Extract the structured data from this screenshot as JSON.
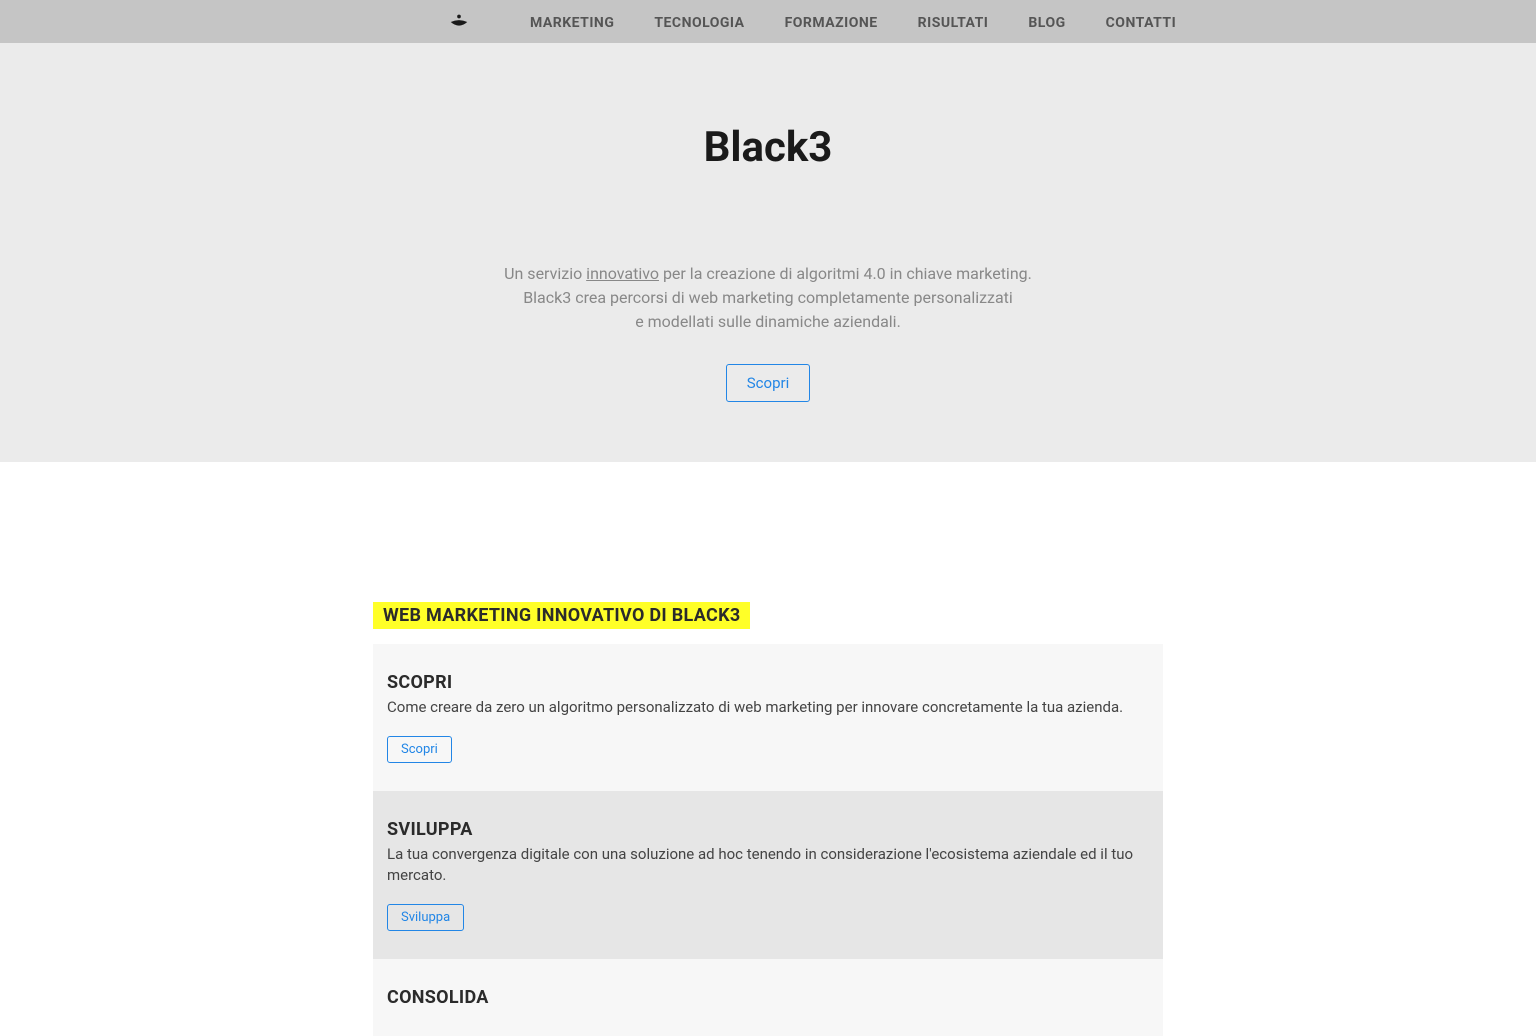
{
  "nav": {
    "items": [
      {
        "label": "MARKETING"
      },
      {
        "label": "TECNOLOGIA"
      },
      {
        "label": "FORMAZIONE"
      },
      {
        "label": "RISULTATI"
      },
      {
        "label": "BLOG"
      },
      {
        "label": "CONTATTI"
      }
    ]
  },
  "hero": {
    "title": "Black3",
    "text_prefix": "Un servizio ",
    "text_underlined": "innovativo",
    "text_line1_suffix": " per la creazione di algoritmi 4.0 in chiave marketing.",
    "text_line2": "Black3 crea percorsi di web marketing completamente personalizzati",
    "text_line3": "e modellati sulle dinamiche aziendali.",
    "button_label": "Scopri"
  },
  "section": {
    "heading": "WEB MARKETING INNOVATIVO DI BLACK3",
    "cards": [
      {
        "title": "SCOPRI",
        "text": "Come creare da zero un algoritmo personalizzato di web marketing per innovare concretamente la tua azienda.",
        "button": "Scopri"
      },
      {
        "title": "SVILUPPA",
        "text": "La tua convergenza digitale con una soluzione ad hoc tenendo in considerazione l'ecosistema aziendale ed il tuo mercato.",
        "button": "Sviluppa"
      },
      {
        "title": "CONSOLIDA"
      }
    ]
  }
}
